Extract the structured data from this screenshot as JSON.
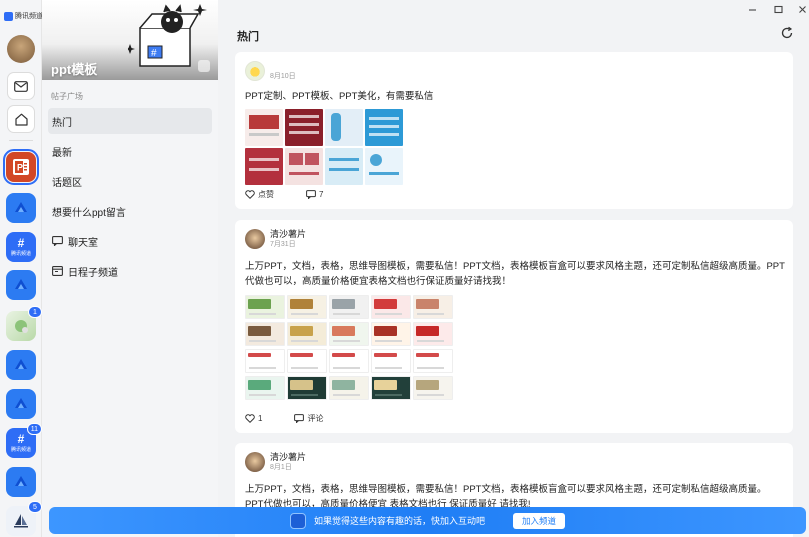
{
  "app": {
    "name": "腾讯频道"
  },
  "rail": {
    "channels": [
      {
        "id": "ppt",
        "badge": ""
      },
      {
        "id": "blue-1",
        "badge": ""
      },
      {
        "id": "qq-1",
        "label": "腾讯频道",
        "badge": ""
      },
      {
        "id": "blue-2",
        "badge": ""
      },
      {
        "id": "photo",
        "badge": "1"
      },
      {
        "id": "blue-3",
        "badge": ""
      },
      {
        "id": "blue-4",
        "badge": ""
      },
      {
        "id": "qq-2",
        "label": "腾讯频道",
        "badge": "11"
      },
      {
        "id": "blue-5",
        "badge": ""
      },
      {
        "id": "sail",
        "badge": "5"
      }
    ]
  },
  "sidebar": {
    "channel_title": "ppt模板",
    "section_label": "帖子广场",
    "items": [
      {
        "label": "热门",
        "active": true
      },
      {
        "label": "最新"
      },
      {
        "label": "话题区"
      },
      {
        "label": "想要什么ppt留言"
      },
      {
        "label": "聊天室",
        "icon": "chat-icon"
      },
      {
        "label": "日程子频道",
        "icon": "calendar-icon"
      }
    ]
  },
  "main": {
    "title": "热门",
    "posts": [
      {
        "author": "​",
        "date": "8月10日",
        "text": "PPT定制、PPT模板、PPT美化，有需要私信",
        "like_label": "点赞",
        "comment_label": "7"
      },
      {
        "author": "清沙薯片",
        "date": "7月31日",
        "text": "上万PPT，文档，表格，思维导图模板，需要私信！PPT文档，表格模板盲盒可以要求风格主题，还可定制私信超级高质量。PPT代做也可以，高质量价格便宜表格文档也行保证质量好请找我！",
        "like_label": "1",
        "comment_label": "评论"
      },
      {
        "author": "清沙薯片",
        "date": "8月1日",
        "text": "上万PPT，文档，表格，思维导图模板，需要私信！PPT文档，表格模板盲盒可以要求风格主题，还可定制私信超级高质量。 PPT代做也可以，高质量价格便宜 表格文档也行 保证质量好 请找我!"
      }
    ]
  },
  "promo": {
    "text": "如果觉得这些内容有趣的话，快加入互动吧",
    "button": "加入频道"
  },
  "colors": {
    "accent": "#2e6df6",
    "promo": "#1f7ef5",
    "ppt": "#d24726"
  }
}
